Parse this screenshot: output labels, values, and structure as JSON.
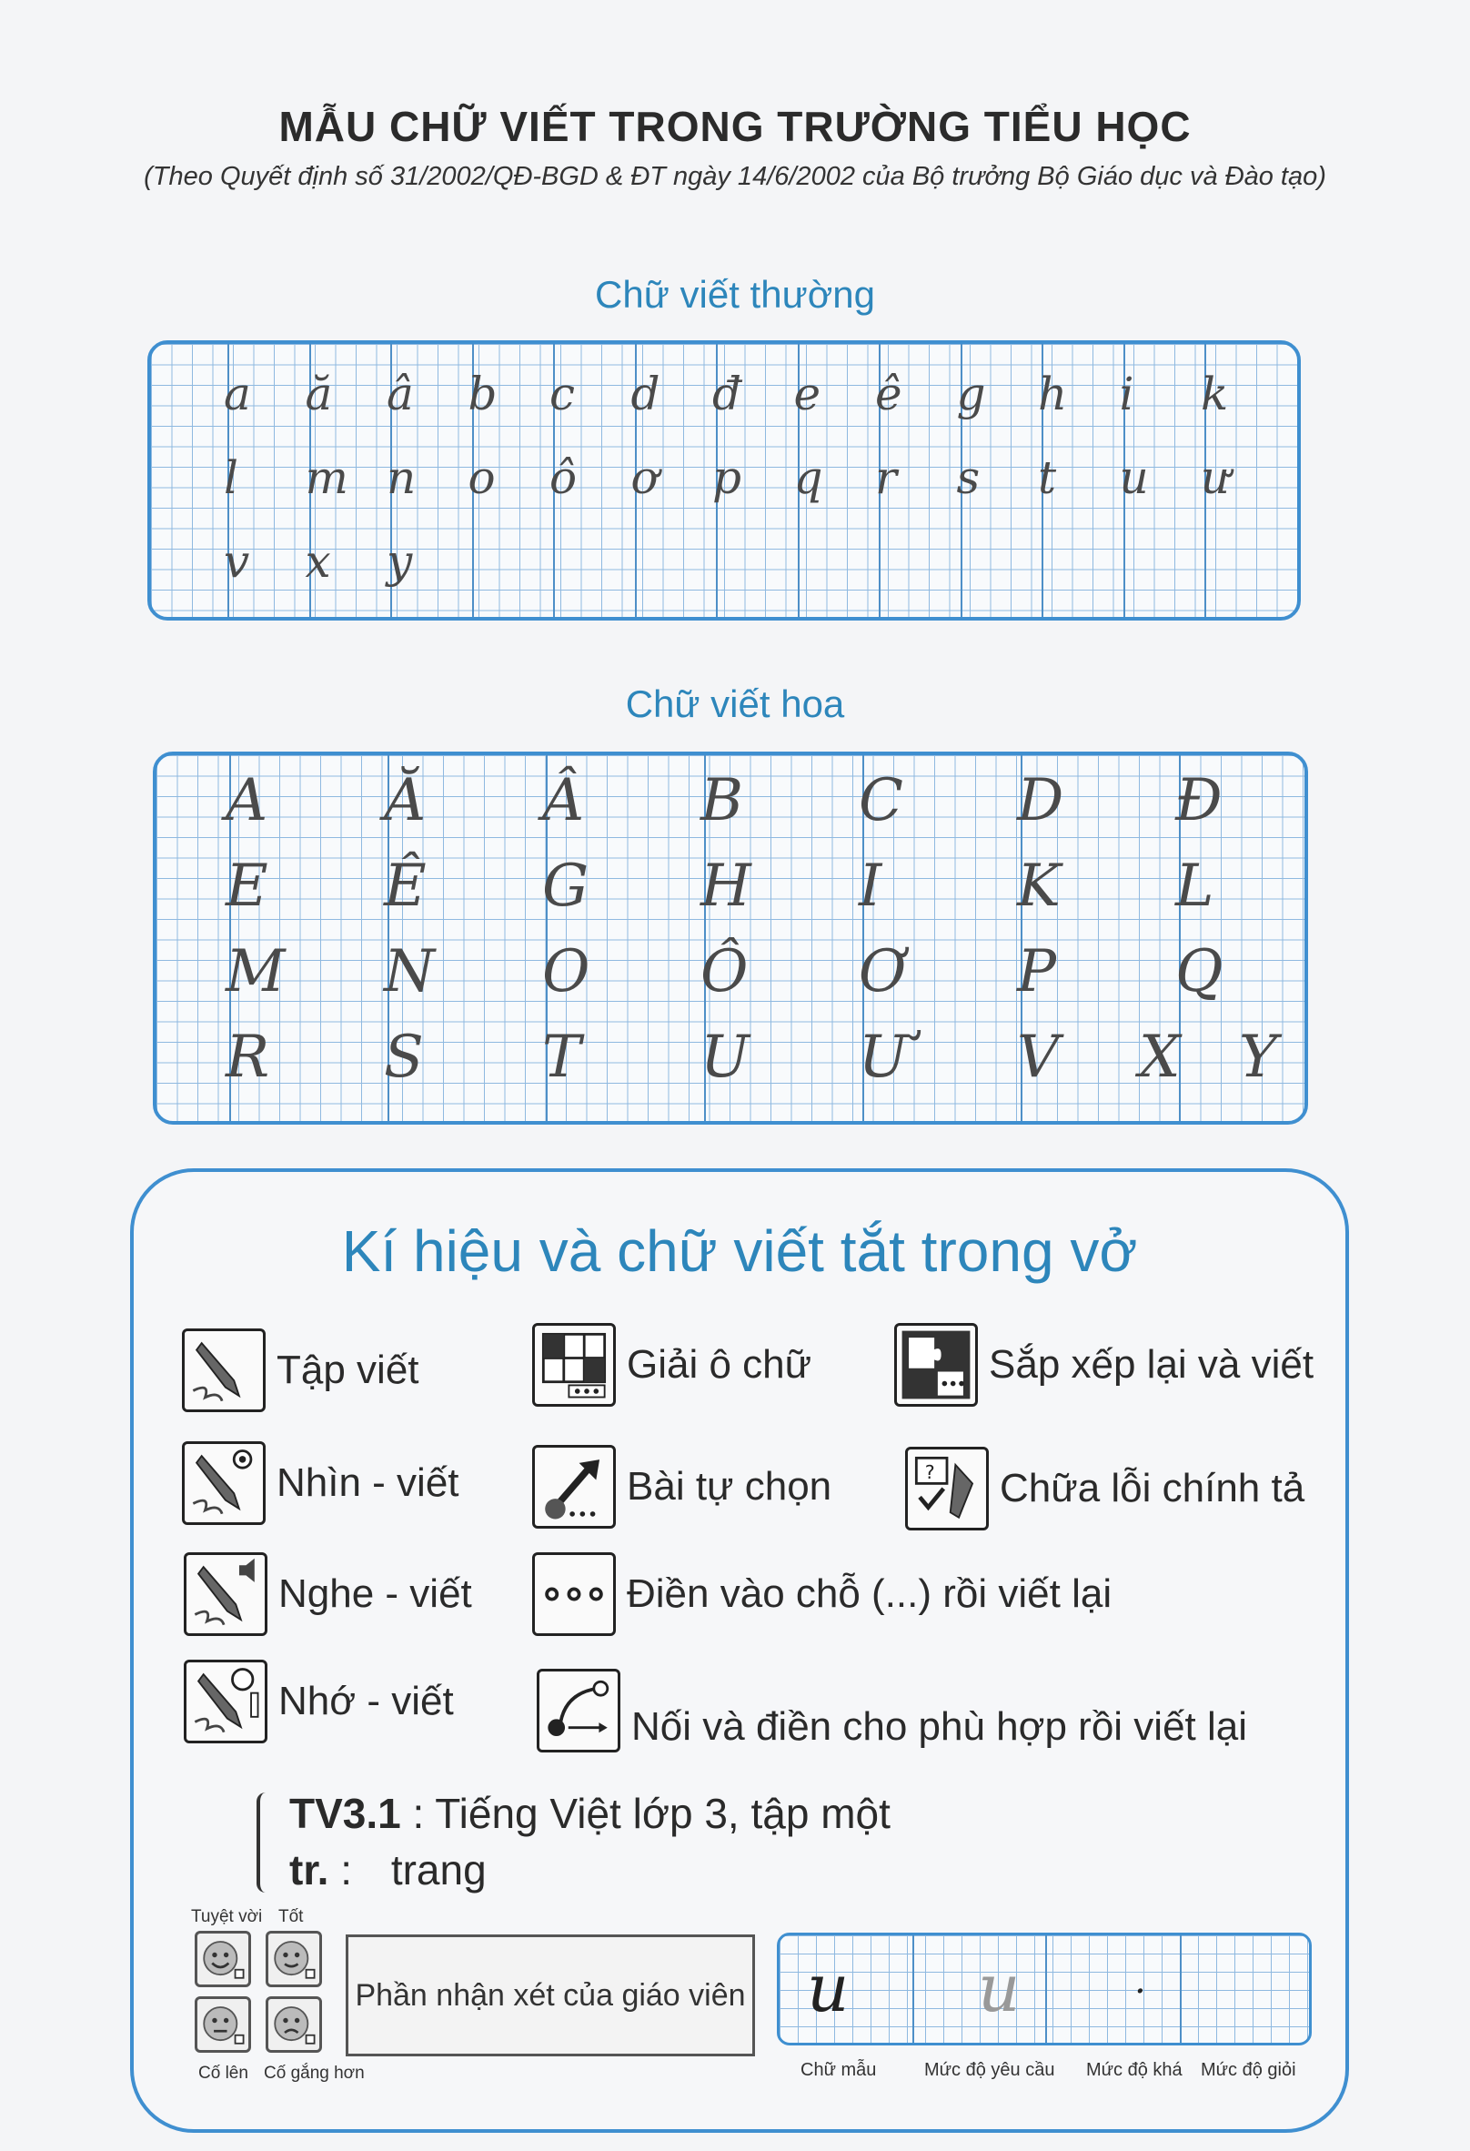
{
  "header": {
    "title": "MẪU CHỮ VIẾT TRONG TRƯỜNG TIỂU HỌC",
    "subtitle": "(Theo Quyết định số 31/2002/QĐ-BGD & ĐT ngày 14/6/2002 của Bộ trưởng Bộ Giáo dục và Đào tạo)"
  },
  "lowercase": {
    "heading": "Chữ viết thường",
    "rows": [
      [
        "a",
        "ă",
        "â",
        "b",
        "c",
        "d",
        "đ",
        "e",
        "ê",
        "g",
        "h",
        "i",
        "k"
      ],
      [
        "l",
        "m",
        "n",
        "o",
        "ô",
        "ơ",
        "p",
        "q",
        "r",
        "s",
        "t",
        "u",
        "ư"
      ],
      [
        "v",
        "x",
        "y"
      ]
    ]
  },
  "uppercase": {
    "heading": "Chữ viết hoa",
    "rows": [
      [
        "A",
        "Ă",
        "Â",
        "B",
        "C",
        "D",
        "Đ"
      ],
      [
        "E",
        "Ê",
        "G",
        "H",
        "I",
        "K",
        "L"
      ],
      [
        "M",
        "N",
        "O",
        "Ô",
        "Ơ",
        "P",
        "Q"
      ],
      [
        "R",
        "S",
        "T",
        "U",
        "Ư",
        "V",
        "X",
        "Y"
      ]
    ]
  },
  "legend": {
    "title": "Kí hiệu và chữ viết tắt trong vở",
    "items": [
      {
        "label": "Tập viết",
        "icon": "pen-writing-icon"
      },
      {
        "label": "Giải ô chữ",
        "icon": "crossword-icon"
      },
      {
        "label": "Sắp xếp lại và viết",
        "icon": "puzzle-icon"
      },
      {
        "label": "Nhìn - viết",
        "icon": "pen-eye-icon"
      },
      {
        "label": "Bài  tự chọn",
        "icon": "arrow-choice-icon"
      },
      {
        "label": "Chữa lỗi chính tả",
        "icon": "spelling-check-icon"
      },
      {
        "label": "Nghe - viết",
        "icon": "pen-speaker-icon"
      },
      {
        "label": "Điền vào chỗ (...) rồi viết lại",
        "icon": "dots-icon"
      },
      {
        "label": "Nhớ - viết",
        "icon": "pen-memory-icon"
      },
      {
        "label": "Nối và điền cho phù hợp rồi viết lại",
        "icon": "connect-icon"
      }
    ]
  },
  "abbreviations": [
    {
      "key": "TV3.1",
      "sep": ":",
      "value": "Tiếng Việt  lớp 3, tập một"
    },
    {
      "key": "tr.",
      "sep": ":",
      "value": "trang"
    }
  ],
  "grading": {
    "faces": [
      "Tuyệt vời",
      "Tốt",
      "Cố lên",
      "Cố gắng hơn"
    ],
    "comment": "Phần nhận xét của giáo viên",
    "sample_letters": [
      "u",
      "u",
      "."
    ],
    "sample_labels": [
      "Chữ mẫu",
      "Mức độ yêu cầu",
      "Mức độ khá",
      "Mức độ giỏi"
    ]
  }
}
